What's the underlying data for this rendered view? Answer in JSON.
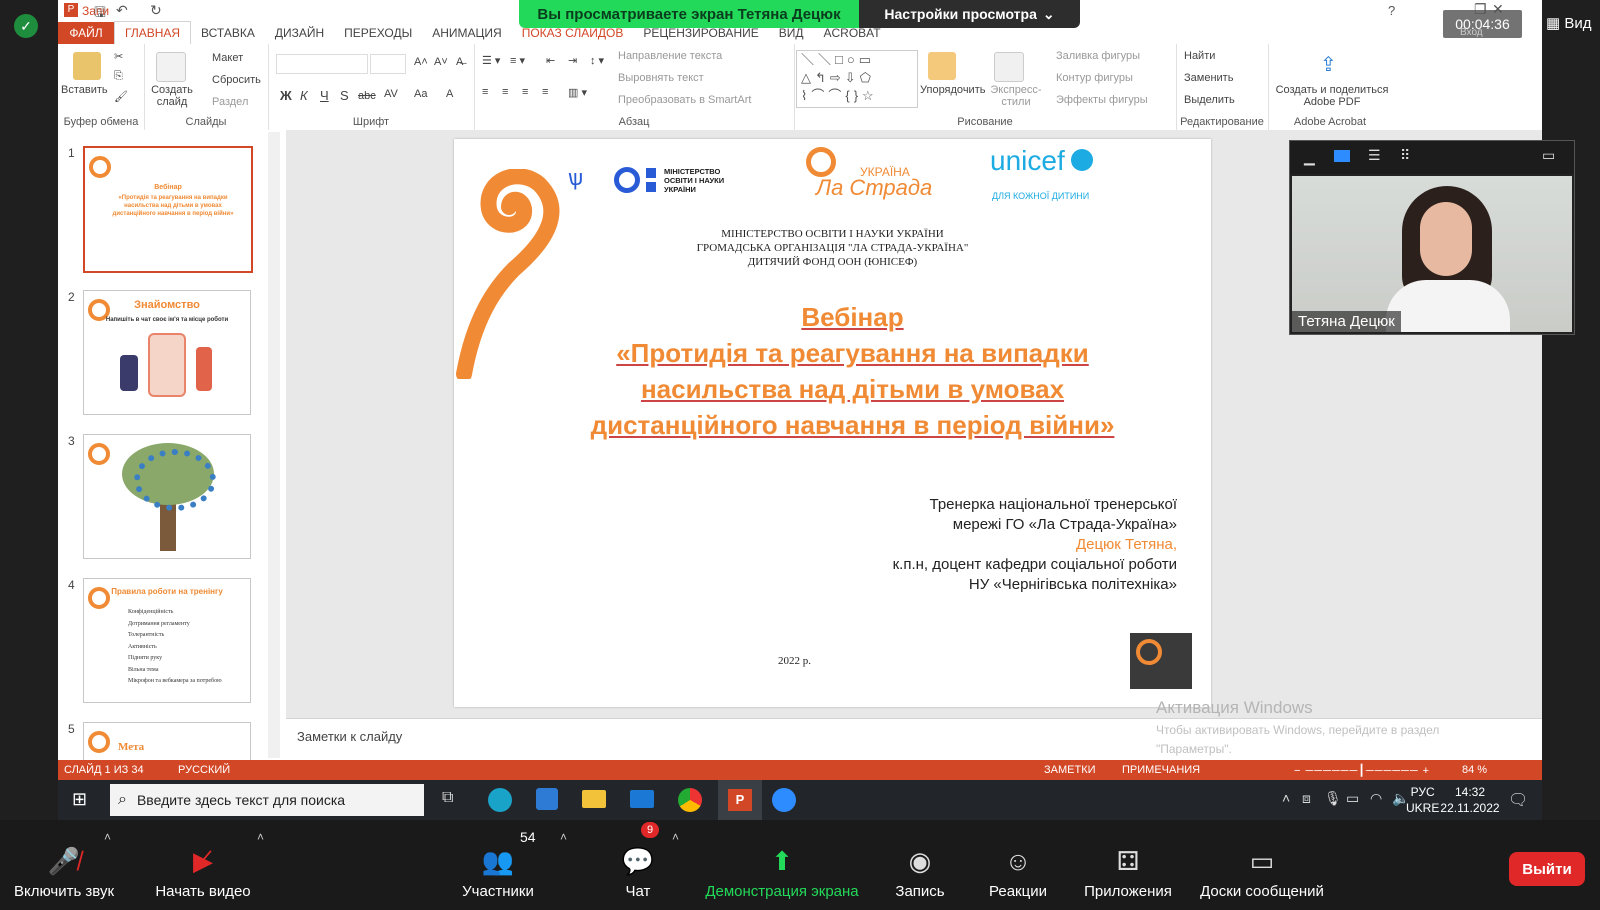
{
  "zoom_banner": {
    "viewing": "Вы просматриваете экран Тетяна Децюк",
    "view_options": "Настройки просмотра"
  },
  "timer": "00:04:36",
  "timer_sub": "Вход",
  "view_label": "Вид",
  "ppt": {
    "title_left": "Запи",
    "tabs": [
      "ФАЙЛ",
      "ГЛАВНАЯ",
      "ВСТАВКА",
      "ДИЗАЙН",
      "ПЕРЕХОДЫ",
      "АНИМАЦИЯ",
      "ПОКАЗ СЛАЙДОВ",
      "РЕЦЕНЗИРОВАНИЕ",
      "ВИД",
      "ACROBAT"
    ],
    "ribbon": {
      "paste": "Вставить",
      "clipboard": "Буфер обмена",
      "new_slide": "Создать слайд",
      "layout": "Макет",
      "reset": "Сбросить",
      "section": "Раздел",
      "slides": "Слайды",
      "font": "Шрифт",
      "text_direction": "Направление текста",
      "align_text": "Выровнять текст",
      "smartart": "Преобразовать в SmartArt",
      "paragraph": "Абзац",
      "arrange": "Упорядочить",
      "quick_styles": "Экспресс-стили",
      "shape_fill": "Заливка фигуры",
      "shape_outline": "Контур фигуры",
      "shape_effects": "Эффекты фигуры",
      "drawing": "Рисование",
      "find": "Найти",
      "replace": "Заменить",
      "select": "Выделить",
      "editing": "Редактирование",
      "create_share_pdf": "Создать и поделиться Adobe PDF",
      "acrobat": "Adobe Acrobat",
      "format_buttons": [
        "Ж",
        "К",
        "Ч",
        "S",
        "abc",
        "AV",
        "Aa",
        "A"
      ]
    },
    "thumbnails": [
      {
        "num": "1",
        "title": "Вебінар",
        "text": "«Протидія та реагування на випадки насильства над дітьми в умовах дистанційного навчання в період війни»"
      },
      {
        "num": "2",
        "title": "Знайомство",
        "text": "Напишіть в чат своє ім'я та місце роботи"
      },
      {
        "num": "3",
        "title": "",
        "text": ""
      },
      {
        "num": "4",
        "title": "Правила роботи на тренінгу",
        "items": [
          "Конфіденційність",
          "Дотримання регламенту",
          "Толерантність",
          "Активність",
          "Підняти руку",
          "Вільна тема",
          "Мікрофон та вебкамера за потребою"
        ]
      },
      {
        "num": "5",
        "title": "Мета",
        "text": ""
      }
    ],
    "slide": {
      "ministry_logo": "МІНІСТЕРСТВО ОСВІТИ І НАУКИ УКРАЇНИ",
      "lastrada_top": "УКРАЇНА",
      "lastrada_main": "Ла Страда",
      "unicef": "unicef",
      "unicef_sub": "ДЛЯ КОЖНОЇ ДИТИНИ",
      "org1": "МІНІСТЕРСТВО ОСВІТИ І НАУКИ УКРАЇНИ",
      "org2": "ГРОМАДСЬКА ОРГАНІЗАЦІЯ \"ЛА СТРАДА-УКРАЇНА\"",
      "org3": "ДИТЯЧИЙ ФОНД ООН (ЮНІСЕФ)",
      "title1": "Вебінар",
      "title2": "«Протидія та реагування на випадки",
      "title3": "насильства над дітьми в умовах",
      "title4": "дистанційного навчання в період війни»",
      "trainer1": "Тренерка національної тренерської",
      "trainer2": "мережі ГО «Ла Страда-Україна»",
      "trainer_name": "Децюк Тетяна,",
      "trainer3": "к.п.н, доцент кафедри соціальної роботи",
      "trainer4": "НУ «Чернігівська політехніка»",
      "year": "2022 р."
    },
    "notes_placeholder": "Заметки к слайду",
    "status": {
      "slide": "СЛАЙД 1 ИЗ 34",
      "lang": "РУССКИЙ",
      "notes": "ЗАМЕТКИ",
      "comments": "ПРИМЕЧАНИЯ",
      "zoom": "84 %"
    },
    "activation": {
      "title": "Активация Windows",
      "line1": "Чтобы активировать Windows, перейдите в раздел",
      "line2": "\"Параметры\"."
    }
  },
  "taskbar": {
    "search": "Введите здесь текст для поиска",
    "lang1": "РУС",
    "lang2": "UKRE",
    "time": "14:32",
    "date": "22.11.2022"
  },
  "video": {
    "name": "Тетяна Децюк"
  },
  "zoom": {
    "mute": "Включить звук",
    "video": "Начать видео",
    "participants": "Участники",
    "participants_count": "54",
    "chat": "Чат",
    "chat_badge": "9",
    "share": "Демонстрация экрана",
    "record": "Запись",
    "reactions": "Реакции",
    "apps": "Приложения",
    "boards": "Доски сообщений",
    "exit": "Выйти"
  },
  "colors": {
    "accent": "#d24726",
    "orange": "#f08a34",
    "share_green": "#23d959",
    "exit_red": "#e02828"
  }
}
